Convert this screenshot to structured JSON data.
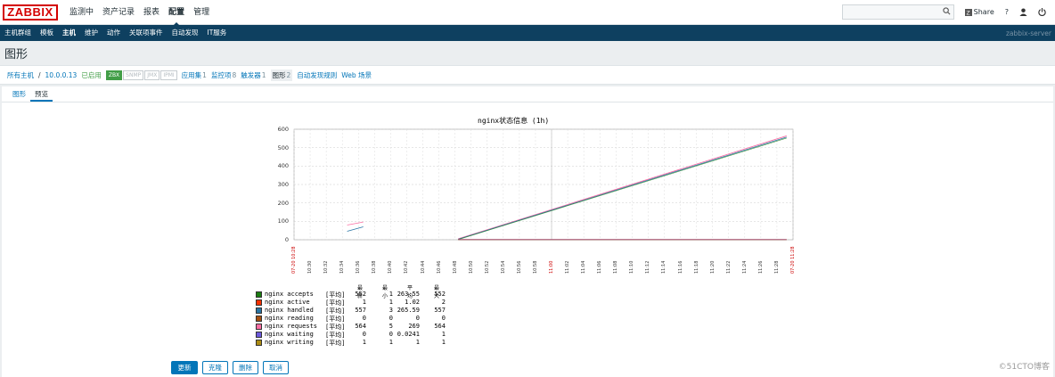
{
  "logo": "ZABBIX",
  "main_menu": [
    "监测中",
    "资产记录",
    "报表",
    "配置",
    "管理"
  ],
  "top_right": {
    "share": "Share",
    "help": "?"
  },
  "sub_menu": [
    "主机群组",
    "模板",
    "主机",
    "维护",
    "动作",
    "关联项事件",
    "自动发现",
    "IT服务"
  ],
  "server_name": "zabbix-server",
  "page_title": "图形",
  "breadcrumb": {
    "all_hosts": "所有主机",
    "host": "10.0.0.13",
    "enabled": "已启用",
    "tags": [
      "ZBX",
      "SNMP",
      "JMX",
      "IPMI"
    ],
    "apps": "应用集",
    "apps_count": "1",
    "items": "监控项",
    "items_count": "8",
    "triggers": "触发器",
    "triggers_count": "1",
    "graphs": "图形",
    "graphs_count": "2",
    "discovery": "自动发现规则",
    "web": "Web 场景"
  },
  "tabs": [
    "图形",
    "预览"
  ],
  "chart_data": {
    "type": "line",
    "title": "nginx状态信息 (1h)",
    "y_ticks": [
      "600",
      "500",
      "400",
      "300",
      "200",
      "100",
      "0"
    ],
    "ylim": [
      0,
      600
    ],
    "x_ticks": [
      "10:30",
      "10:32",
      "10:34",
      "10:36",
      "10:38",
      "10:40",
      "10:42",
      "10:44",
      "10:46",
      "10:48",
      "10:50",
      "10:52",
      "10:54",
      "10:56",
      "10:58",
      "11:00",
      "11:02",
      "11:04",
      "11:06",
      "11:08",
      "11:10",
      "11:12",
      "11:14",
      "11:16",
      "11:18",
      "11:20",
      "11:22",
      "11:24",
      "11:26",
      "11:28"
    ],
    "x_start_label": "07-20 10:28",
    "x_mid_label": "11:00",
    "x_end_label": "07-20 11:28",
    "grid": true,
    "series": [
      {
        "name": "nginx accepts",
        "color": "#1a7c11",
        "fn": "[平均]",
        "last": "552",
        "min": "1",
        "avg": "263.55",
        "max": "552"
      },
      {
        "name": "nginx active",
        "color": "#f63100",
        "fn": "[平均]",
        "last": "1",
        "min": "1",
        "avg": "1.02",
        "max": "2"
      },
      {
        "name": "nginx handled",
        "color": "#2774a4",
        "fn": "[平均]",
        "last": "557",
        "min": "3",
        "avg": "265.59",
        "max": "557"
      },
      {
        "name": "nginx reading",
        "color": "#a54f10",
        "fn": "[平均]",
        "last": "0",
        "min": "0",
        "avg": "0",
        "max": "0"
      },
      {
        "name": "nginx requests",
        "color": "#fc6ea3",
        "fn": "[平均]",
        "last": "564",
        "min": "5",
        "avg": "269",
        "max": "564"
      },
      {
        "name": "nginx waiting",
        "color": "#6c59dc",
        "fn": "[平均]",
        "last": "0",
        "min": "0",
        "avg": "0.0241",
        "max": "1"
      },
      {
        "name": "nginx writing",
        "color": "#ac8c14",
        "fn": "[平均]",
        "last": "1",
        "min": "1",
        "avg": "1",
        "max": "1"
      }
    ],
    "legend_headers": [
      "最新",
      "最小",
      "平均",
      "最大"
    ]
  },
  "buttons": {
    "update": "更新",
    "clone": "克隆",
    "delete": "删除",
    "cancel": "取消"
  },
  "watermark_footer": "©51CTO博客"
}
